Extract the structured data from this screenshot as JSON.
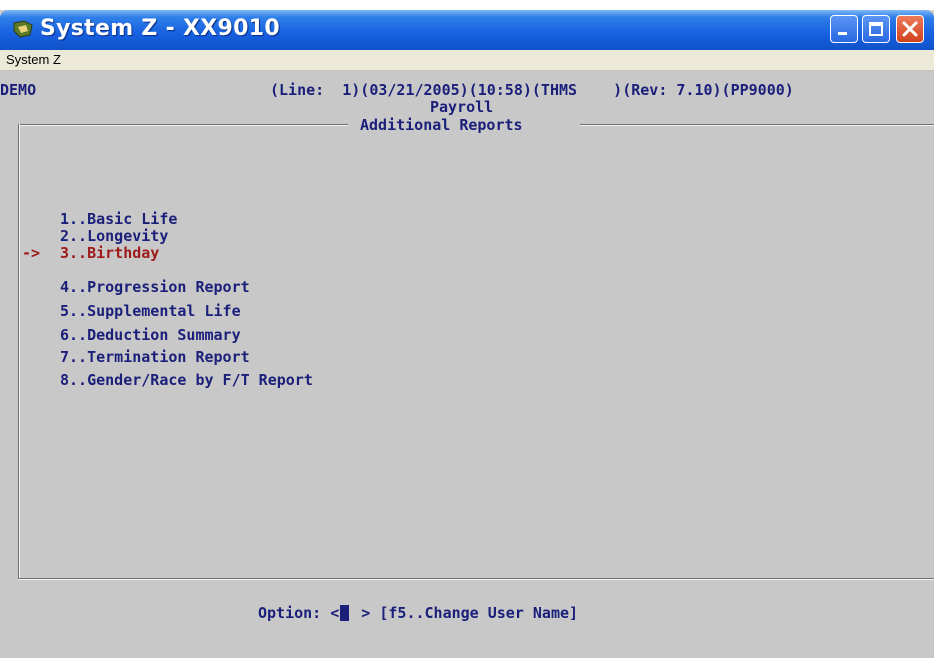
{
  "window": {
    "title": "System Z - XX9010",
    "controls": {
      "minimize": "minimize",
      "maximize": "maximize",
      "close": "close"
    }
  },
  "menubar": {
    "items": [
      {
        "label": "System Z"
      }
    ]
  },
  "status_line": {
    "left": "DEMO",
    "middle": "(Line:  1)(03/21/2005)(10:58)(THMS    )(Rev: 7.10)(PP9000)"
  },
  "header": {
    "module": "Payroll",
    "title": "Additional Reports"
  },
  "menu": {
    "selected_indicator": "->",
    "selected_index": 2,
    "options": [
      {
        "label": "1..Basic Life"
      },
      {
        "label": "2..Longevity"
      },
      {
        "label": "3..Birthday"
      },
      {
        "label": "4..Progression Report"
      },
      {
        "label": "5..Supplemental Life"
      },
      {
        "label": "6..Deduction Summary"
      },
      {
        "label": "7..Termination Report"
      },
      {
        "label": "8..Gender/Race by F/T Report"
      }
    ]
  },
  "footer": {
    "option_label": "Option: <",
    "option_value": "",
    "option_close": " >",
    "hint": "[f5..Change User Name]"
  },
  "colors": {
    "screen_bg": "#c8c8c8",
    "text": "#1a1f7a",
    "selected": "#9e1a1a",
    "titlebar": "#1760e0"
  }
}
